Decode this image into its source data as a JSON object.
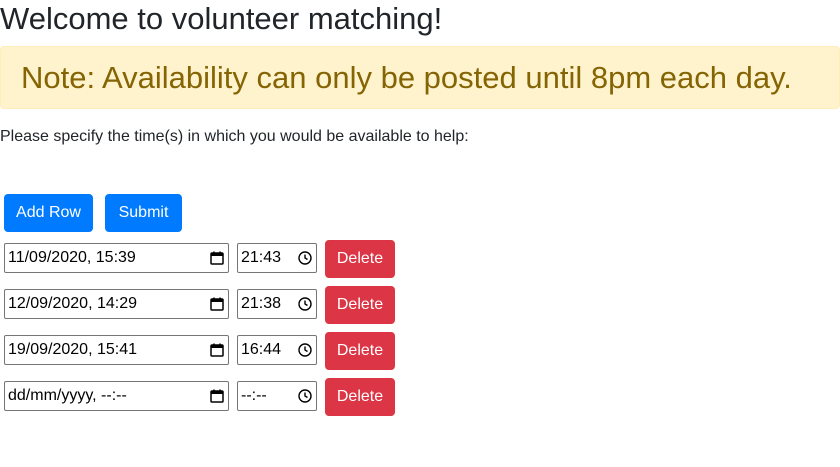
{
  "page": {
    "title": "Welcome to volunteer matching!",
    "note": "Note: Availability can only be posted until 8pm each day.",
    "instructions": "Please specify the time(s) in which you would be available to help:"
  },
  "buttons": {
    "add_row": "Add Row",
    "submit": "Submit"
  },
  "rows": [
    {
      "datetime": "11/09/2020, 15:39",
      "time": "21:43",
      "delete": "Delete"
    },
    {
      "datetime": "12/09/2020, 14:29",
      "time": "21:38",
      "delete": "Delete"
    },
    {
      "datetime": "19/09/2020, 15:41",
      "time": "16:44",
      "delete": "Delete"
    },
    {
      "datetime": "dd/mm/yyyy, --:--",
      "time": "--:--",
      "delete": "Delete"
    }
  ],
  "icons": {
    "datetime": "calendar-icon",
    "time": "clock-icon"
  },
  "colors": {
    "primary": "#007bff",
    "danger": "#dc3545",
    "warning_bg": "#fff3cd",
    "warning_text": "#856404"
  }
}
